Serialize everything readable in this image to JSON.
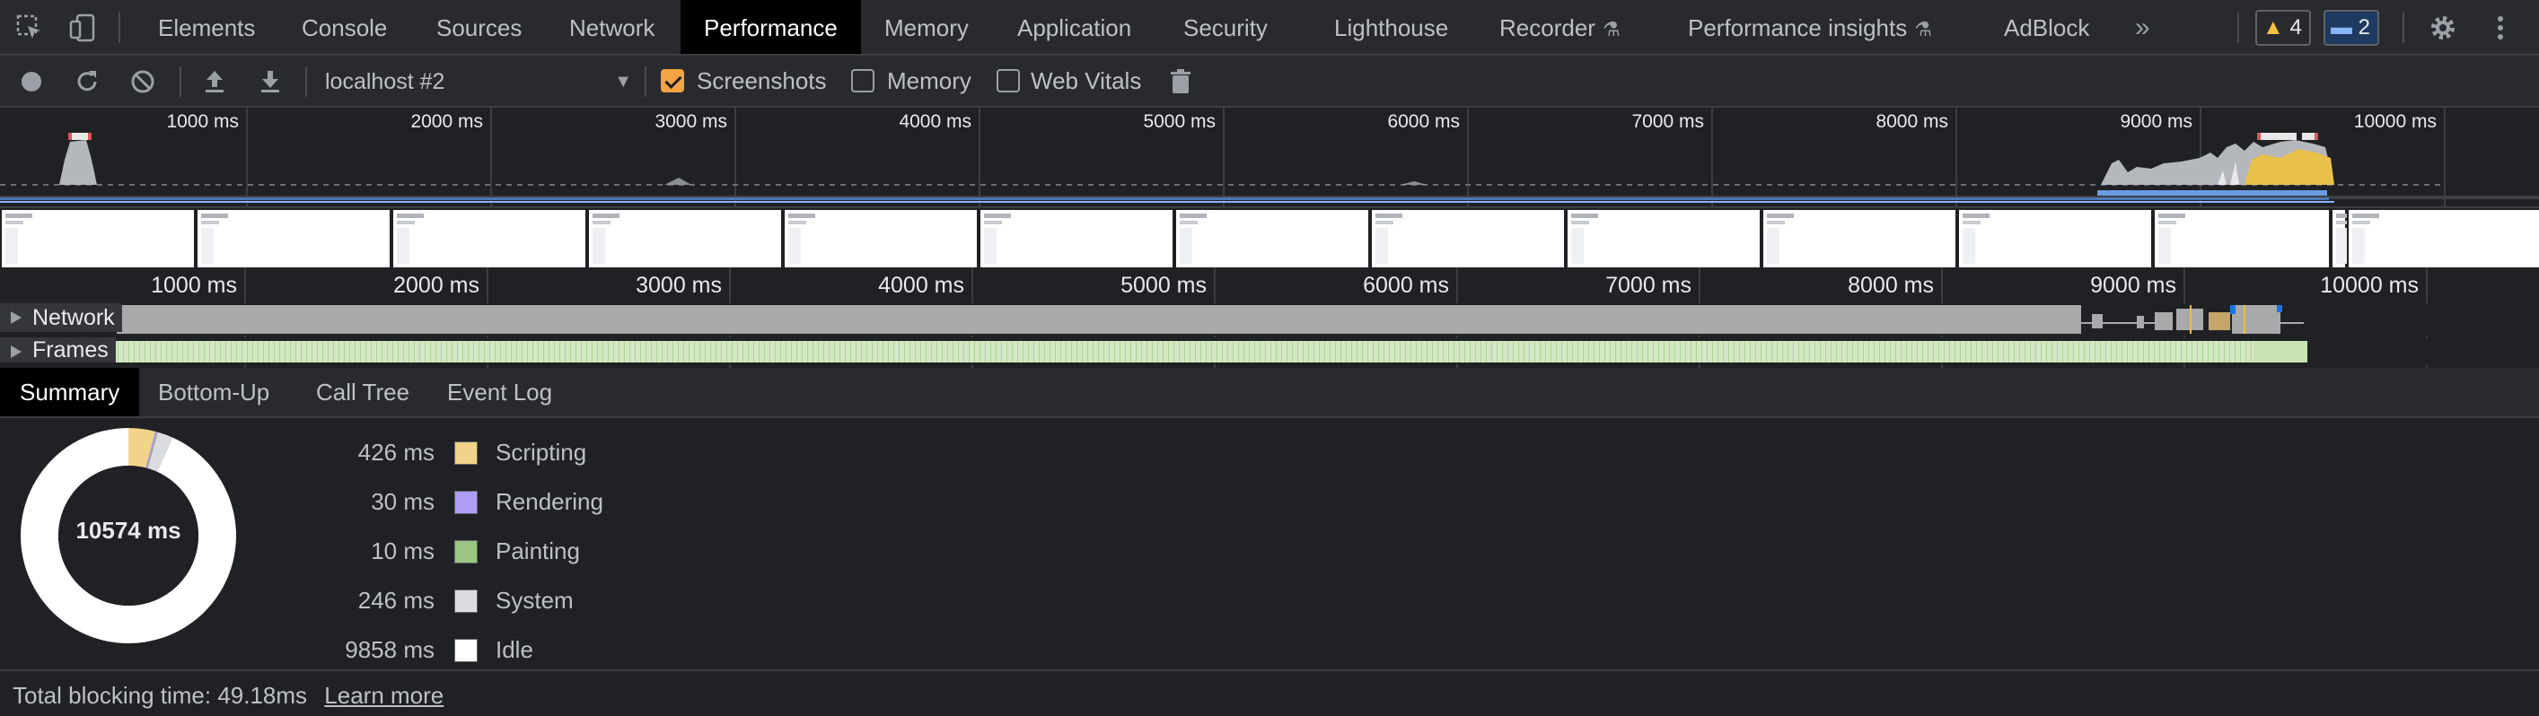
{
  "devtools": {
    "tabs": [
      {
        "label": "Elements"
      },
      {
        "label": "Console"
      },
      {
        "label": "Sources"
      },
      {
        "label": "Network"
      },
      {
        "label": "Performance",
        "active": true
      },
      {
        "label": "Memory"
      },
      {
        "label": "Application"
      },
      {
        "label": "Security"
      },
      {
        "label": "Lighthouse"
      },
      {
        "label": "Recorder",
        "experimental": true
      },
      {
        "label": "Performance insights",
        "experimental": true
      },
      {
        "label": "AdBlock"
      }
    ],
    "more_tabs": "»",
    "warnings_count": "4",
    "messages_count": "2"
  },
  "toolbar": {
    "target_select": "localhost #2",
    "checkboxes": [
      {
        "label": "Screenshots",
        "checked": true
      },
      {
        "label": "Memory",
        "checked": false
      },
      {
        "label": "Web Vitals",
        "checked": false
      }
    ]
  },
  "timeline": {
    "ticks": [
      "1000 ms",
      "2000 ms",
      "3000 ms",
      "4000 ms",
      "5000 ms",
      "6000 ms",
      "7000 ms",
      "8000 ms",
      "9000 ms",
      "10000 ms"
    ],
    "tracks": [
      {
        "label": "Network"
      },
      {
        "label": "Frames"
      }
    ]
  },
  "bottom_tabs": [
    {
      "label": "Summary",
      "active": true
    },
    {
      "label": "Bottom-Up"
    },
    {
      "label": "Call Tree"
    },
    {
      "label": "Event Log"
    }
  ],
  "summary": {
    "total": "10574 ms",
    "items": [
      {
        "value": "426 ms",
        "name": "Scripting",
        "ms": 426,
        "color": "#f2d38a"
      },
      {
        "value": "30 ms",
        "name": "Rendering",
        "ms": 30,
        "color": "#af9df3"
      },
      {
        "value": "10 ms",
        "name": "Painting",
        "ms": 10,
        "color": "#9cc783"
      },
      {
        "value": "246 ms",
        "name": "System",
        "ms": 246,
        "color": "#dadce0"
      },
      {
        "value": "9858 ms",
        "name": "Idle",
        "ms": 9858,
        "color": "#ffffff"
      }
    ]
  },
  "footer": {
    "blocking_text": "Total blocking time: 49.18ms",
    "learn_more": "Learn more"
  }
}
